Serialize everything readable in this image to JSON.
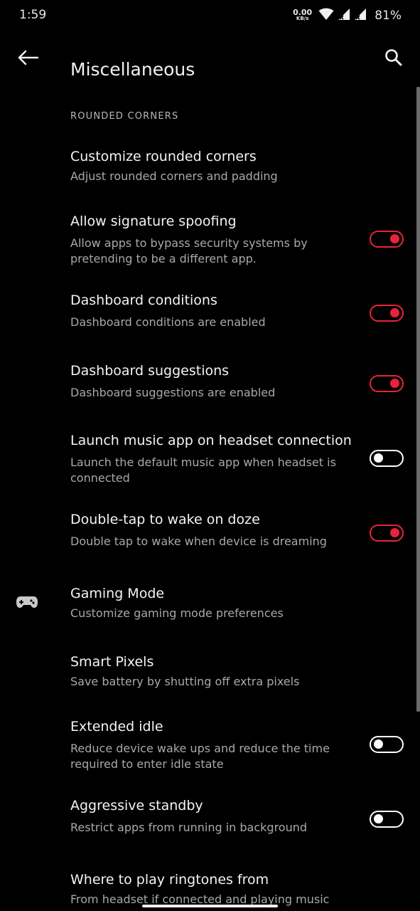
{
  "status": {
    "time": "1:59",
    "net_speed_value": "0.00",
    "net_speed_unit": "KB/s",
    "battery": "81%"
  },
  "app_bar": {
    "title": "Miscellaneous"
  },
  "section": {
    "header": "ROUNDED CORNERS"
  },
  "items": [
    {
      "title": "Customize rounded corners",
      "summary": "Adjust rounded corners and padding"
    },
    {
      "title": "Allow signature spoofing",
      "summary": "Allow apps to bypass security systems by pretending to be a different app.",
      "toggle": true
    },
    {
      "title": "Dashboard conditions",
      "summary": "Dashboard conditions are enabled",
      "toggle": true
    },
    {
      "title": "Dashboard suggestions",
      "summary": "Dashboard suggestions are enabled",
      "toggle": true
    },
    {
      "title": "Launch music app on headset connection",
      "summary": "Launch the default music app when headset is connected",
      "toggle": false
    },
    {
      "title": "Double-tap to wake on doze",
      "summary": "Double tap to wake when device is dreaming",
      "toggle": true
    },
    {
      "title": "Gaming Mode",
      "summary": "Customize gaming mode preferences",
      "icon": "gamepad-icon"
    },
    {
      "title": "Smart Pixels",
      "summary": "Save battery by shutting off extra pixels"
    },
    {
      "title": "Extended idle",
      "summary": "Reduce device wake ups and reduce the time required to enter idle state",
      "toggle": false
    },
    {
      "title": "Aggressive standby",
      "summary": "Restrict apps from running in background",
      "toggle": false
    },
    {
      "title": "Where to play ringtones from",
      "summary": "From headset if connected and playing music"
    }
  ],
  "colors": {
    "accent": "#e8233b",
    "background": "#000000"
  }
}
